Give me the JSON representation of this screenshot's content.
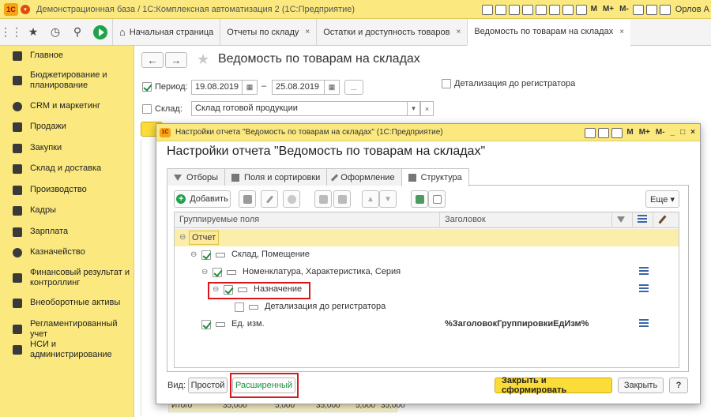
{
  "titlebar": {
    "title": "Демонстрационная база / 1С:Комплексная автоматизация 2  (1С:Предприятие)",
    "logo": "1С",
    "m_labels": [
      "M",
      "M+",
      "M-"
    ],
    "user": "Орлов А"
  },
  "tabstrip": {
    "tabs": [
      {
        "label": "Начальная страница",
        "closable": false
      },
      {
        "label": "Отчеты по складу",
        "closable": true
      },
      {
        "label": "Остатки и доступность товаров",
        "closable": true
      },
      {
        "label": "Ведомость по товарам на складах",
        "closable": true,
        "active": true
      }
    ],
    "close_glyph": "×"
  },
  "sidebar": {
    "items": [
      {
        "label": "Главное",
        "icon": "menu-icon"
      },
      {
        "label": "Бюджетирование и планирование",
        "icon": "budget-icon"
      },
      {
        "label": "CRM и маркетинг",
        "icon": "crm-icon"
      },
      {
        "label": "Продажи",
        "icon": "sales-icon"
      },
      {
        "label": "Закупки",
        "icon": "cart-icon"
      },
      {
        "label": "Склад и доставка",
        "icon": "warehouse-icon"
      },
      {
        "label": "Производство",
        "icon": "factory-icon"
      },
      {
        "label": "Кадры",
        "icon": "personnel-icon"
      },
      {
        "label": "Зарплата",
        "icon": "salary-icon"
      },
      {
        "label": "Казначейство",
        "icon": "treasury-icon"
      },
      {
        "label": "Финансовый результат и контроллинг",
        "icon": "finance-icon"
      },
      {
        "label": "Внеоборотные активы",
        "icon": "assets-icon"
      },
      {
        "label": "Регламентированный учет",
        "icon": "regulated-icon"
      },
      {
        "label": "НСИ и администрирование",
        "icon": "admin-icon"
      }
    ]
  },
  "form": {
    "title": "Ведомость по товарам на складах",
    "period_label": "Период:",
    "period_from": "19.08.2019",
    "period_to": "25.08.2019",
    "period_sep": "–",
    "period_more": "...",
    "detail_label": "Детализация до регистратора",
    "warehouse_label": "Склад:",
    "warehouse_value": "Склад готовой продукции",
    "totals": {
      "label": "Итого",
      "values": [
        "35,000",
        "5,000",
        "35,000",
        "5,000",
        "35,000"
      ]
    }
  },
  "dialog": {
    "window_title": "Настройки отчета \"Ведомость по товарам на складах\" (1С:Предприятие)",
    "heading": "Настройки отчета \"Ведомость по товарам на складах\"",
    "tabs": [
      "Отборы",
      "Поля и сортировки",
      "Оформление",
      "Структура"
    ],
    "active_tab": "Структура",
    "toolbar": {
      "add_label": "Добавить",
      "more_label": "Еще ▾"
    },
    "grid": {
      "col_fields": "Группируемые поля",
      "col_header": "Заголовок",
      "rows": [
        {
          "label": "Отчет",
          "level": 0,
          "checkbox": false,
          "header": ""
        },
        {
          "label": "Склад, Помещение",
          "level": 1,
          "checkbox": true,
          "header": ""
        },
        {
          "label": "Номенклатура, Характеристика, Серия",
          "level": 2,
          "checkbox": true,
          "header": ""
        },
        {
          "label": "Назначение",
          "level": 3,
          "checkbox": true,
          "header": ""
        },
        {
          "label": "Детализация до регистратора",
          "level": 4,
          "checkbox": false,
          "header": ""
        },
        {
          "label": "Ед. изм.",
          "level": 1,
          "checkbox": true,
          "header": "%ЗаголовокГруппировкиЕдИзм%"
        }
      ]
    },
    "footer": {
      "view_label": "Вид:",
      "simple_label": "Простой",
      "extended_label": "Расширенный",
      "close_build_label": "Закрыть и сформировать",
      "close_label": "Закрыть",
      "help_label": "?"
    }
  },
  "colors": {
    "accent_yellow": "#fbe97f",
    "primary_button": "#fbdc39",
    "highlight_red": "#d9171d",
    "go_green": "#1fa34a"
  }
}
